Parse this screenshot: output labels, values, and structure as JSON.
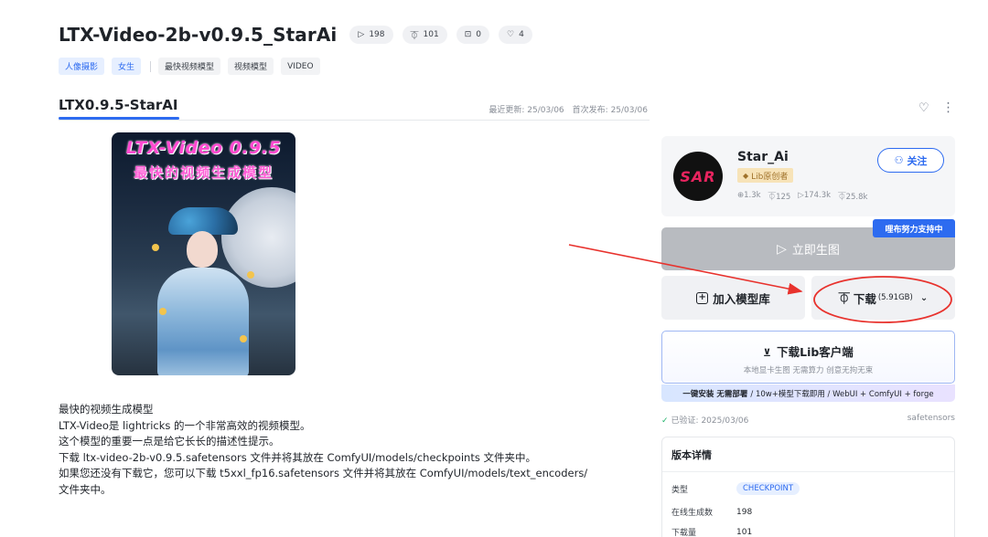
{
  "header": {
    "title": "LTX-Video-2b-v0.9.5_StarAi",
    "stats": [
      {
        "icon": "play-icon",
        "glyph": "▷",
        "value": "198"
      },
      {
        "icon": "download-count-icon",
        "glyph": "⏁",
        "value": "101"
      },
      {
        "icon": "image-icon",
        "glyph": "⊡",
        "value": "0"
      },
      {
        "icon": "heart-icon",
        "glyph": "♡",
        "value": "4"
      }
    ]
  },
  "tags": {
    "primary": [
      "人像摄影",
      "女生"
    ],
    "secondary": [
      "最快视频模型",
      "视频模型",
      "VIDEO"
    ]
  },
  "version": {
    "name": "LTX0.9.5-StarAI",
    "updated": "最近更新: 25/03/06",
    "published": "首次发布: 25/03/06"
  },
  "cover": {
    "line1": "LTX-Video 0.9.5",
    "line2": "最快的视频生成模型"
  },
  "description": [
    "最快的视频生成模型",
    "LTX-Video是 lightricks 的一个非常高效的视频模型。",
    "这个模型的重要一点是给它长长的描述性提示。",
    "下载 ltx-video-2b-v0.9.5.safetensors 文件并将其放在 ComfyUI/models/checkpoints 文件夹中。",
    "如果您还没有下载它，您可以下载 t5xxl_fp16.safetensors 文件并将其放在 ComfyUI/models/text_encoders/",
    "文件夹中。"
  ],
  "author": {
    "avatar_text": "SAR",
    "name": "Star_Ai",
    "badge": "Lib原创者",
    "followers": "⊕1.3k",
    "likes": "⏁125",
    "runs": "▷174.3k",
    "downloads": "⏁25.8k",
    "follow_label": "关注"
  },
  "support_badge": "哩布努力支持中",
  "actions": {
    "generate_label": "立即生图",
    "add_library_label": "加入模型库",
    "download_label": "下载",
    "download_size": "(5.91GB)"
  },
  "client": {
    "title": "下载Lib客户端",
    "subtitle": "本地显卡生图 无需算力 创意无拘无束",
    "strip_bold": "一键安装 无需部署",
    "strip_rest": "/ 10w+模型下载即用 / WebUI + ComfyUI + forge"
  },
  "verification": {
    "verified": "已验证: 2025/03/06",
    "format": "safetensors"
  },
  "details": {
    "title": "版本详情",
    "rows": [
      {
        "key": "类型",
        "value": "CHECKPOINT"
      },
      {
        "key": "在线生成数",
        "value": "198"
      },
      {
        "key": "下载量",
        "value": "101"
      }
    ]
  },
  "colors": {
    "accent": "#2d6bf0",
    "annotation_red": "#e8322d"
  }
}
